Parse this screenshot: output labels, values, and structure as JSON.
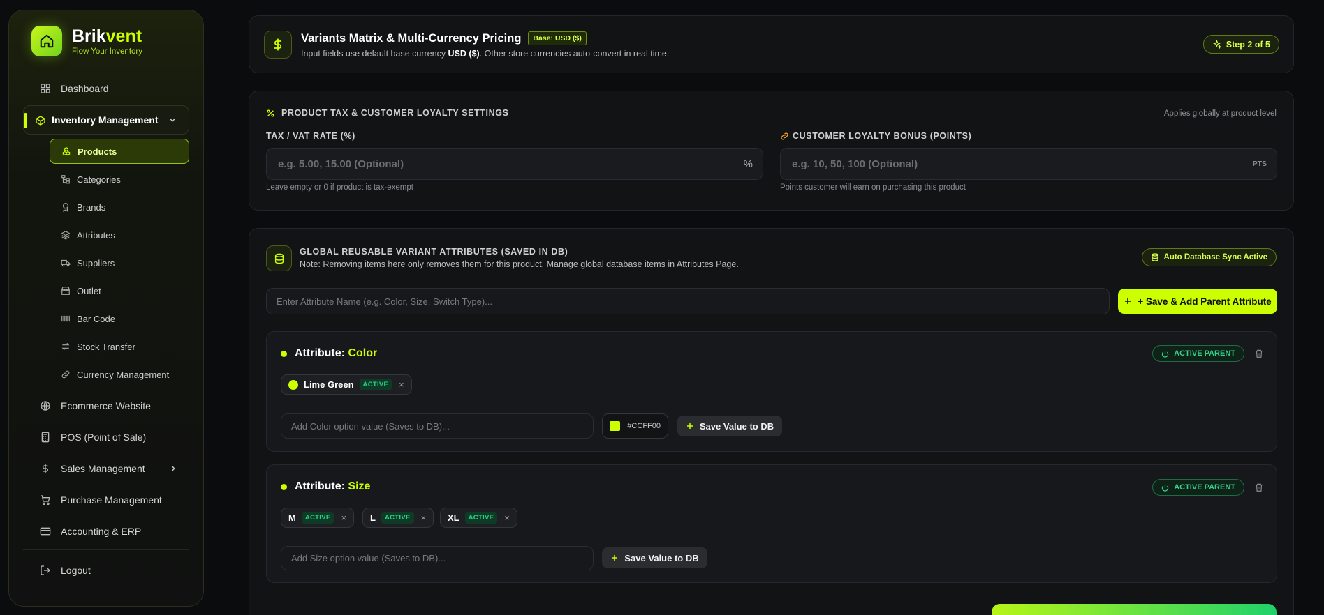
{
  "sidebar": {
    "brand": {
      "name_a": "Brik",
      "name_b": "vent",
      "tagline": "Flow Your Inventory"
    },
    "nav_top": [
      {
        "label": "Dashboard",
        "icon": "grid-icon"
      }
    ],
    "inventory": {
      "label": "Inventory Management",
      "icon": "box-icon"
    },
    "sub_items": [
      {
        "label": "Products",
        "icon": "cubes-icon"
      },
      {
        "label": "Categories",
        "icon": "hierarchy-icon"
      },
      {
        "label": "Brands",
        "icon": "award-icon"
      },
      {
        "label": "Attributes",
        "icon": "layers-icon"
      },
      {
        "label": "Suppliers",
        "icon": "truck-icon"
      },
      {
        "label": "Outlet",
        "icon": "store-icon"
      },
      {
        "label": "Bar Code",
        "icon": "barcode-icon"
      },
      {
        "label": "Stock Transfer",
        "icon": "transfer-icon"
      },
      {
        "label": "Currency Management",
        "icon": "link-icon"
      }
    ],
    "nav_lower": [
      {
        "label": "Ecommerce Website",
        "icon": "globe-icon"
      },
      {
        "label": "POS (Point of Sale)",
        "icon": "calculator-icon"
      },
      {
        "label": "Sales Management",
        "icon": "dollar-icon"
      },
      {
        "label": "Purchase Management",
        "icon": "cart-icon"
      },
      {
        "label": "Accounting & ERP",
        "icon": "card-icon"
      }
    ],
    "logout": "Logout"
  },
  "header": {
    "title": "Variants Matrix & Multi-Currency Pricing",
    "base_badge": "Base: USD ($)",
    "sub_pre": "Input fields use default base currency ",
    "sub_bold": "USD ($)",
    "sub_post": ". Other store currencies auto-convert in real time.",
    "step": "Step 2 of 5"
  },
  "tax": {
    "section_title": "PRODUCT TAX & CUSTOMER LOYALTY SETTINGS",
    "scope_note": "Applies globally at product level",
    "tax_label": "TAX / VAT RATE (%)",
    "tax_placeholder": "e.g. 5.00, 15.00 (Optional)",
    "tax_suffix": "%",
    "tax_help": "Leave empty or 0 if product is tax-exempt",
    "loyalty_label": "CUSTOMER LOYALTY BONUS (POINTS)",
    "loyalty_placeholder": "e.g. 10, 50, 100 (Optional)",
    "loyalty_suffix": "PTS",
    "loyalty_help": "Points customer will earn on purchasing this product"
  },
  "attributes": {
    "section_title": "GLOBAL REUSABLE VARIANT ATTRIBUTES (SAVED IN DB)",
    "note": "Note: Removing items here only removes them for this product. Manage global database items in Attributes Page.",
    "sync_badge": "Auto Database Sync Active",
    "name_placeholder": "Enter Attribute Name (e.g. Color, Size, Switch Type)...",
    "add_parent_button": "+ Save & Add Parent Attribute",
    "attr_prefix": "Attribute: ",
    "active_parent": "ACTIVE PARENT",
    "save_value_button": "Save Value to DB",
    "color": {
      "name": "Color",
      "values": [
        {
          "label": "Lime Green",
          "status": "ACTIVE",
          "swatch": "#ccff00"
        }
      ],
      "option_placeholder": "Add Color option value (Saves to DB)...",
      "hex_value": "#CCFF00"
    },
    "size": {
      "name": "Size",
      "values": [
        {
          "label": "M",
          "status": "ACTIVE"
        },
        {
          "label": "L",
          "status": "ACTIVE"
        },
        {
          "label": "XL",
          "status": "ACTIVE"
        }
      ],
      "option_placeholder": "Add Size option value (Saves to DB)..."
    }
  },
  "colors": {
    "accent": "#ccff00",
    "success": "#29d18a",
    "background": "#0b0c0e"
  }
}
